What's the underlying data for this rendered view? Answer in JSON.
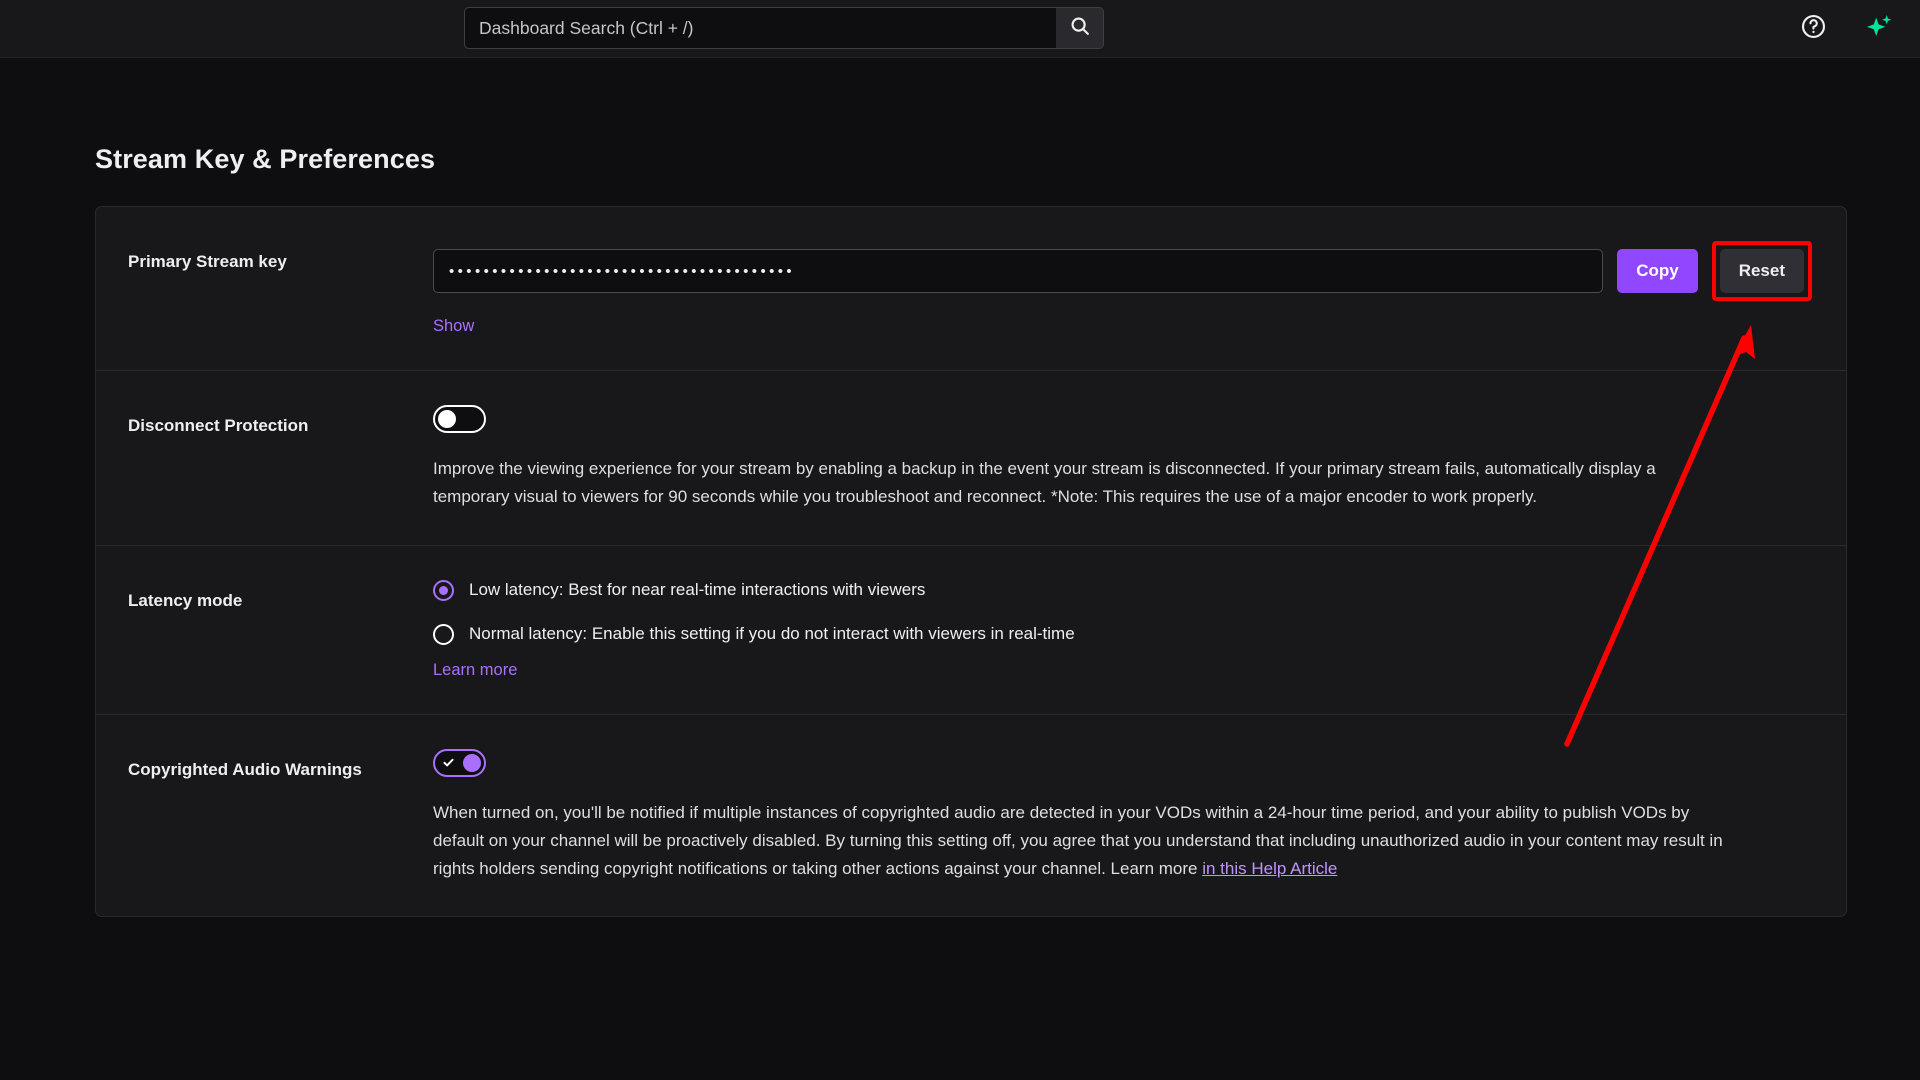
{
  "topbar": {
    "search": {
      "placeholder": "Dashboard Search (Ctrl + /)",
      "value": ""
    },
    "search_icon": "search-icon",
    "help_icon": "help-circle-icon",
    "sparkle_icon": "sparkle-icon"
  },
  "page": {
    "title": "Stream Key & Preferences"
  },
  "stream_key": {
    "label": "Primary Stream key",
    "value": "••••••••••••••••••••••••••••••••••••••••",
    "show_link": "Show",
    "copy_label": "Copy",
    "reset_label": "Reset"
  },
  "disconnect_protection": {
    "label": "Disconnect Protection",
    "toggle_state": "off",
    "description": "Improve the viewing experience for your stream by enabling a backup in the event your stream is disconnected. If your primary stream fails, automatically display a temporary visual to viewers for 90 seconds while you troubleshoot and reconnect. *Note: This requires the use of a major encoder to work properly."
  },
  "latency_mode": {
    "label": "Latency mode",
    "options": [
      {
        "label": "Low latency: Best for near real-time interactions with viewers",
        "selected": true
      },
      {
        "label": "Normal latency: Enable this setting if you do not interact with viewers in real-time",
        "selected": false
      }
    ],
    "learn_more": "Learn more"
  },
  "copyrighted_audio": {
    "label": "Copyrighted Audio Warnings",
    "toggle_state": "on",
    "description_part1": "When turned on, you'll be notified if multiple instances of copyrighted audio are detected in your VODs within a 24-hour time period, and your ability to publish VODs by default on your channel will be proactively disabled. By turning this setting off, you agree that you understand that including unauthorized audio in your content may result in rights holders sending copyright notifications or taking other actions against your channel. Learn more ",
    "help_article_link": "in this Help Article"
  },
  "annotation": {
    "highlight_color": "#ff0000",
    "arrow_color": "#ff0000",
    "target": "reset-button"
  },
  "colors": {
    "accent_purple": "#9147ff",
    "link_purple": "#a970ff",
    "page_bg": "#0e0e10",
    "card_bg": "#18181b",
    "sparkle_green": "#00e39a"
  }
}
